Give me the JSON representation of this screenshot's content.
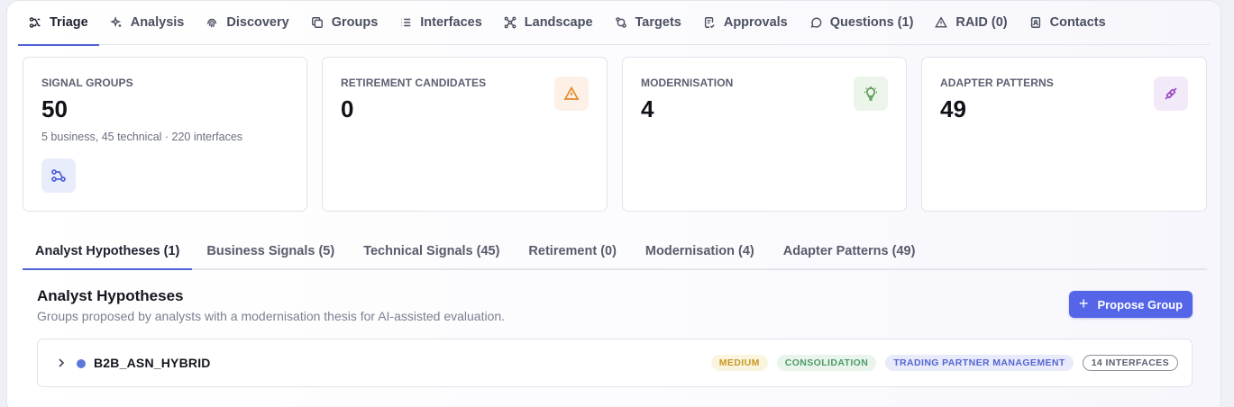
{
  "tabs": [
    {
      "label": "Triage",
      "icon": "triage-icon",
      "active": true
    },
    {
      "label": "Analysis",
      "icon": "sparkles-icon"
    },
    {
      "label": "Discovery",
      "icon": "fingerprint-icon"
    },
    {
      "label": "Groups",
      "icon": "copy-icon"
    },
    {
      "label": "Interfaces",
      "icon": "list-icon"
    },
    {
      "label": "Landscape",
      "icon": "network-icon"
    },
    {
      "label": "Targets",
      "icon": "target-icon"
    },
    {
      "label": "Approvals",
      "icon": "clipboard-check-icon"
    },
    {
      "label": "Questions (1)",
      "icon": "message-circle-icon"
    },
    {
      "label": "RAID (0)",
      "icon": "warning-triangle-icon"
    },
    {
      "label": "Contacts",
      "icon": "contacts-icon"
    }
  ],
  "cards": {
    "signal_groups": {
      "label": "SIGNAL GROUPS",
      "value": "50",
      "sub": "5 business, 45 technical · 220 interfaces",
      "icon": "workflow-icon"
    },
    "retirement": {
      "label": "RETIREMENT CANDIDATES",
      "value": "0",
      "icon": "warning-triangle-icon"
    },
    "modernisation": {
      "label": "MODERNISATION",
      "value": "4",
      "icon": "lightbulb-icon"
    },
    "adapter": {
      "label": "ADAPTER PATTERNS",
      "value": "49",
      "icon": "plug-icon"
    }
  },
  "colors": {
    "accent": "#5465e8",
    "retirement_icon": "#e08a2c",
    "modernisation_icon": "#5c9a55",
    "adapter_icon": "#9a4fc2",
    "signal_icon": "#4f62d6"
  },
  "subtabs": [
    {
      "label": "Analyst Hypotheses (1)",
      "active": true
    },
    {
      "label": "Business Signals (5)"
    },
    {
      "label": "Technical Signals (45)"
    },
    {
      "label": "Retirement (0)"
    },
    {
      "label": "Modernisation (4)"
    },
    {
      "label": "Adapter Patterns (49)"
    }
  ],
  "section": {
    "title": "Analyst Hypotheses",
    "description": "Groups proposed by analysts with a modernisation thesis for AI-assisted evaluation.",
    "propose_label": "Propose Group",
    "propose_icon": "plus-icon"
  },
  "row": {
    "name": "B2B_ASN_HYBRID",
    "badges": {
      "priority": "MEDIUM",
      "type": "CONSOLIDATION",
      "domain": "TRADING PARTNER MANAGEMENT",
      "interfaces": "14 INTERFACES"
    }
  }
}
